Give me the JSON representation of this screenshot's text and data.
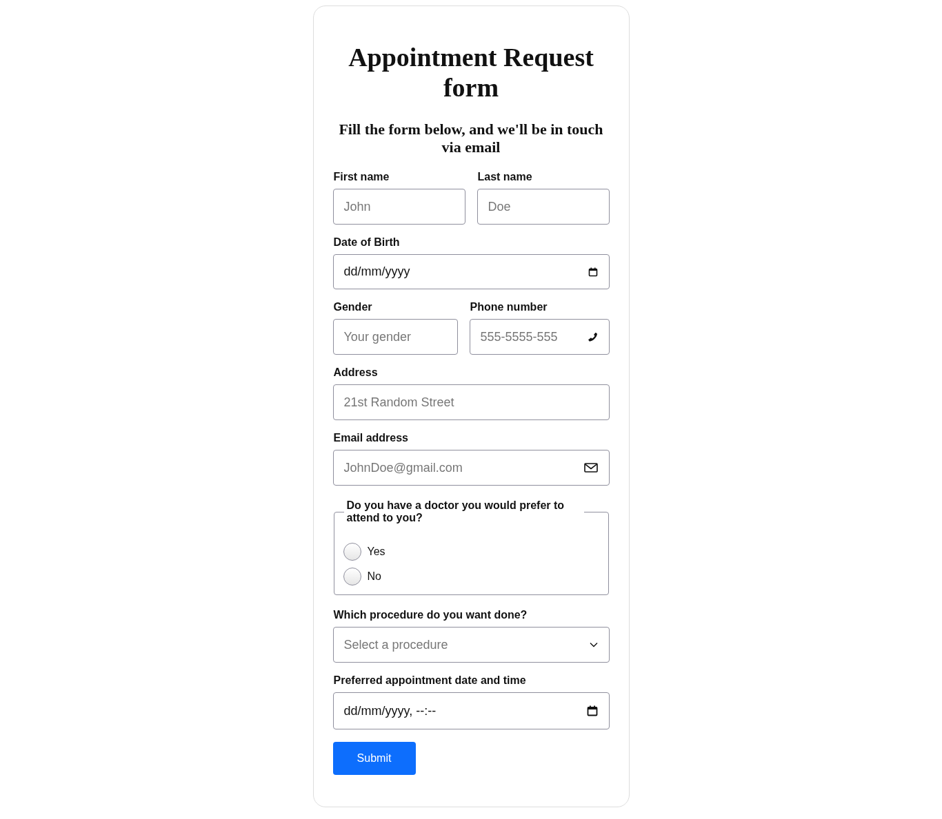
{
  "title": "Appointment Request form",
  "subtitle": "Fill the form below, and we'll be in touch via email",
  "sections": [
    {
      "kind": "fields",
      "fields": [
        {
          "kind": "text",
          "label": "First name",
          "placeholder": "John"
        },
        {
          "kind": "text",
          "label": "Last name",
          "placeholder": "Doe"
        }
      ]
    },
    {
      "kind": "fields",
      "fields": [
        {
          "kind": "date",
          "label": "Date of Birth",
          "value": "dd/mm/yyyy"
        }
      ]
    },
    {
      "kind": "fields",
      "fields": [
        {
          "kind": "text",
          "label": "Gender",
          "placeholder": "Your gender"
        },
        {
          "kind": "phone",
          "label": "Phone number",
          "placeholder": "555-5555-555"
        }
      ]
    },
    {
      "kind": "fields",
      "fields": [
        {
          "kind": "text",
          "label": "Address",
          "placeholder": "21st Random Street"
        }
      ]
    },
    {
      "kind": "fields",
      "fields": [
        {
          "kind": "email",
          "label": "Email address",
          "placeholder": "JohnDoe@gmail.com"
        }
      ]
    },
    {
      "kind": "choice",
      "legend": "Do you have a doctor you would prefer to attend to you?",
      "options": [
        {
          "label": "Yes",
          "selected": false
        },
        {
          "label": "No",
          "selected": false
        }
      ]
    },
    {
      "kind": "fields",
      "fields": [
        {
          "kind": "select",
          "label": "Which procedure do you want done?",
          "placeholder": "Select a procedure"
        }
      ]
    },
    {
      "kind": "fields",
      "fields": [
        {
          "kind": "datetime",
          "label": "Preferred appointment date and time",
          "value": "dd/mm/yyyy, --:--"
        }
      ]
    }
  ],
  "submit": "Submit"
}
